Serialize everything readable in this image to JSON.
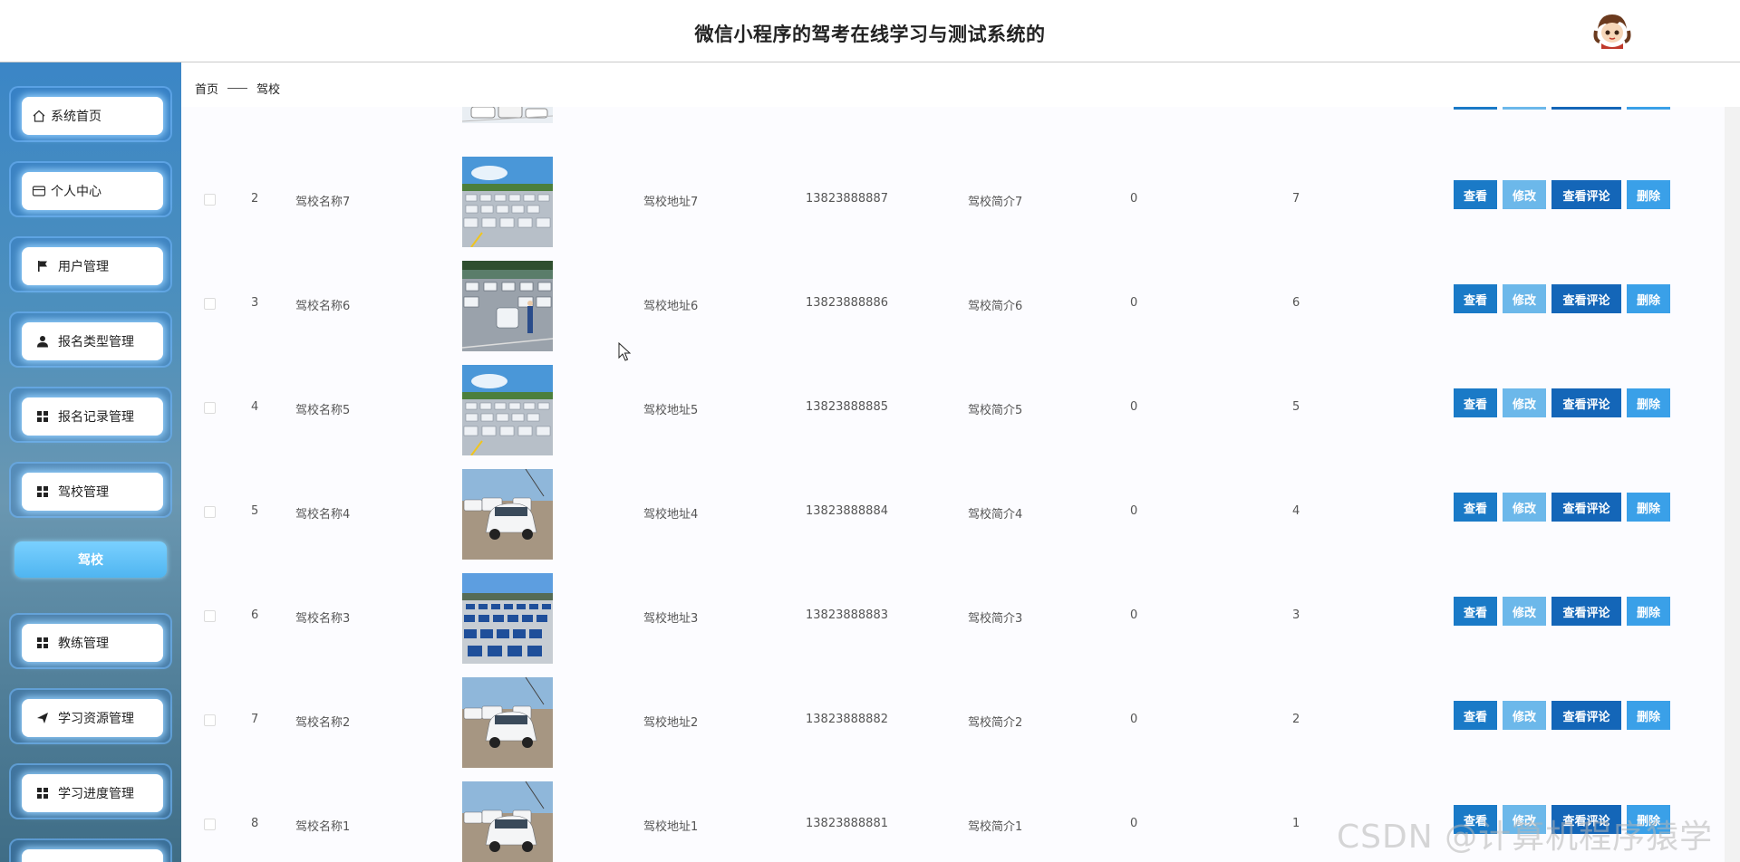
{
  "header": {
    "title": "微信小程序的驾考在线学习与测试系统的"
  },
  "sidebar": {
    "items": [
      {
        "label": "系统首页",
        "icon": "home-icon"
      },
      {
        "label": "个人中心",
        "icon": "card-icon"
      },
      {
        "label": "用户管理",
        "icon": "flag-icon"
      },
      {
        "label": "报名类型管理",
        "icon": "user-icon"
      },
      {
        "label": "报名记录管理",
        "icon": "grid-icon"
      },
      {
        "label": "驾校管理",
        "icon": "grid-icon"
      },
      {
        "label": "教练管理",
        "icon": "grid-icon"
      },
      {
        "label": "学习资源管理",
        "icon": "send-icon"
      },
      {
        "label": "学习进度管理",
        "icon": "grid-icon"
      }
    ],
    "active_sub": "驾校"
  },
  "breadcrumb": {
    "home": "首页",
    "current": "驾校"
  },
  "actions": {
    "view": "查看",
    "edit": "修改",
    "comments": "查看评论",
    "delete": "删除"
  },
  "rows": [
    {
      "index": "2",
      "name": "驾校名称7",
      "address": "驾校地址7",
      "phone": "13823888887",
      "intro": "驾校简介7",
      "col_a": "0",
      "col_b": "7",
      "image": "parking-lot-photo"
    },
    {
      "index": "3",
      "name": "驾校名称6",
      "address": "驾校地址6",
      "phone": "13823888886",
      "intro": "驾校简介6",
      "col_a": "0",
      "col_b": "6",
      "image": "driving-school-photo"
    },
    {
      "index": "4",
      "name": "驾校名称5",
      "address": "驾校地址5",
      "phone": "13823888885",
      "intro": "驾校简介5",
      "col_a": "0",
      "col_b": "5",
      "image": "parking-lot-photo"
    },
    {
      "index": "5",
      "name": "驾校名称4",
      "address": "驾校地址4",
      "phone": "13823888884",
      "intro": "驾校简介4",
      "col_a": "0",
      "col_b": "4",
      "image": "white-car-photo"
    },
    {
      "index": "6",
      "name": "驾校名称3",
      "address": "驾校地址3",
      "phone": "13823888883",
      "intro": "驾校简介3",
      "col_a": "0",
      "col_b": "3",
      "image": "blue-cars-photo"
    },
    {
      "index": "7",
      "name": "驾校名称2",
      "address": "驾校地址2",
      "phone": "13823888882",
      "intro": "驾校简介2",
      "col_a": "0",
      "col_b": "2",
      "image": "white-car-photo"
    },
    {
      "index": "8",
      "name": "驾校名称1",
      "address": "驾校地址1",
      "phone": "13823888881",
      "intro": "驾校简介1",
      "col_a": "0",
      "col_b": "1",
      "image": "white-car-photo"
    }
  ],
  "watermark": "CSDN @计算机程序猿学长",
  "colors": {
    "view": "#1a7ac7",
    "edit": "#6cb8ea",
    "comments": "#1466b8",
    "delete": "#3aa0e8"
  }
}
